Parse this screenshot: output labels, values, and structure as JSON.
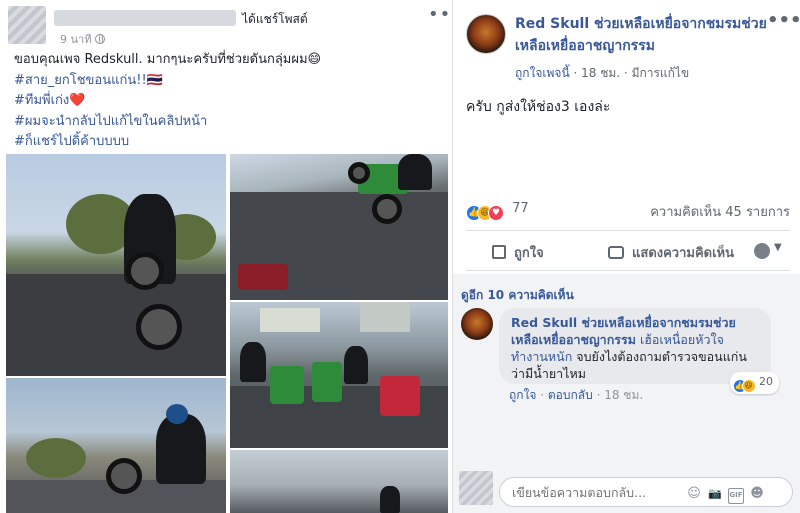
{
  "post": {
    "shared_text": "ได้แชร์โพสต์",
    "time": "9 นาที",
    "lines": [
      "ขอบคุณเพจ Redskull. มากๆนะครับที่ช่วยดันกลุ่มผม😄",
      "#สาย_ยกโชขอนแก่น!!🇹🇭",
      "#ทีมพี่เก่ง",
      "#ผมจะนำกลับไปแก้ไขในคลิปหน้า",
      "#ก็แชร์ไปดิ้ค้าบบบบ"
    ],
    "heart": "❤️"
  },
  "page": {
    "name": "Red Skull ช่วยเหลือเหยื่อจากชมรมช่วยเหลือเหยื่ออาชญากรรม",
    "liked_page": "ถูกใจเพจนี้",
    "time": "18 ชม.",
    "edited": "มีการแก้ไข",
    "text": "ครับ กูส่งให้ช่อง3 เองล่ะ"
  },
  "stats": {
    "reaction_count": "77",
    "comment_count": "ความคิดเห็น 45 รายการ"
  },
  "actions": {
    "like": "ถูกใจ",
    "comment": "แสดงความคิดเห็น"
  },
  "comments": {
    "more": "ดูอีก 10 ความคิดเห็น",
    "author": "Red Skull ช่วยเหลือเหยื่อจากชมรมช่วยเหลือเหยื่ออาชญากรรม",
    "mention": "เฮ้อเหนื่อยหัวใจทำงานหนัก",
    "text": "จบยังไงต้องถามตำรวจขอนแก่นว่ามีน้ำยาไหม",
    "reaction_count": "20",
    "like": "ถูกใจ",
    "reply": "ตอบกลับ",
    "time": "18 ชม."
  },
  "reply_box": {
    "placeholder": "เขียนข้อความตอบกลับ..."
  },
  "icons": {
    "emoji": "☺",
    "camera": "📷",
    "gif": "GIF",
    "sticker": "☻"
  },
  "colors": {
    "link": "#385898",
    "like": "#1877f2",
    "love": "#f33e58",
    "haha": "#f7b928"
  }
}
